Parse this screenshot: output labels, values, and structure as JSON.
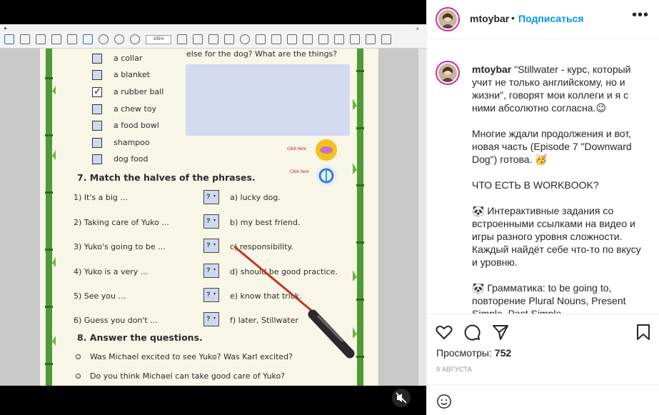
{
  "post": {
    "username": "mtoybar",
    "separator": "•",
    "follow_label": "Подписаться",
    "more_label": "•••",
    "caption_paragraphs": [
      "\"Stillwater - курс, который учит не только английскому, но и жизни\", говорят мои коллеги и я с ними абсолютно согласна.😉",
      "Многие ждали продолжения и вот, новая часть (Episode 7 \"Downward Dog\") готова. 🥳",
      "ЧТО ЕСТЬ В WORKBOOK?",
      "🐼 Интерактивные задания со встроенными ссылками на видео и игры разного уровня сложности. Каждый найдёт себе что-то по вкусу и уровню.",
      "🐼 Грамматика: to be going to, повторение Plural Nouns, Present Simple, Past Simple"
    ],
    "views_label": "Просмотры:",
    "views_count": "752",
    "date": "9 АВГУСТА",
    "comment_placeholder": ""
  },
  "toolbar": {
    "zoom": "105%",
    "close": "×"
  },
  "worksheet": {
    "top_question": "else for the dog? What are the things?",
    "checklist": [
      {
        "label": "a collar",
        "checked": false
      },
      {
        "label": "a blanket",
        "checked": false
      },
      {
        "label": "a rubber ball",
        "checked": true
      },
      {
        "label": "a chew toy",
        "checked": false
      },
      {
        "label": "a food bowl",
        "checked": false
      },
      {
        "label": "shampoo",
        "checked": false
      },
      {
        "label": "dog food",
        "checked": false
      }
    ],
    "click_here": "Click here",
    "section7_title": "7. Match the halves of the phrases.",
    "phrases_left": [
      "1) It's a big ...",
      "2) Taking care of Yuko ...",
      "3) Yuko's going to be ...",
      "4) Yuko is a very ...",
      "5) See you ...",
      "6) Guess you don't ..."
    ],
    "phrases_right": [
      "a) lucky dog.",
      "b) my best friend.",
      "c) responsibility.",
      "d) should be good practice.",
      "e) know that trick.",
      "f) later, Stillwater"
    ],
    "answer_placeholder": "?",
    "dropdown_glyph": "▾",
    "section8_title": "8. Answer the questions.",
    "questions": [
      "Was Michael excited to see Yuko? Was Karl excited?",
      "Do you think Michael can take good care of Yuko?"
    ],
    "check_mark": "✓"
  },
  "colors": {
    "accent_blue": "#0095f6",
    "answer_box_fill": "#cfd8ef",
    "sheet_bg": "#f8f6e6",
    "bamboo_green": "#4f9a34"
  }
}
